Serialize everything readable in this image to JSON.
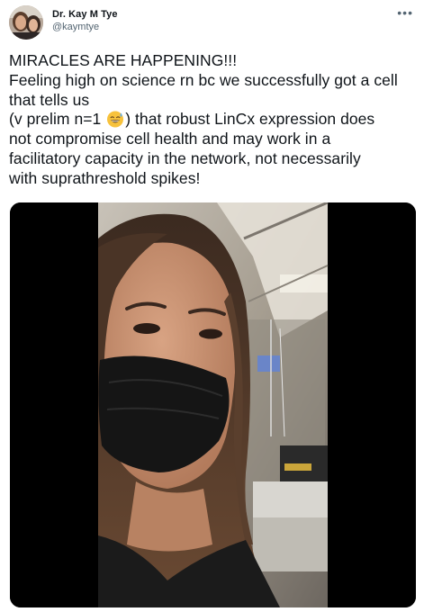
{
  "author": {
    "display_name": "Dr. Kay M Tye",
    "handle": "@kaymtye",
    "avatar_icon": "profile-photo"
  },
  "more_icon": "more-horizontal-icon",
  "tweet": {
    "line1": "MIRACLES ARE HAPPENING!!!",
    "line2": "Feeling high on science rn bc we successfully got a cell",
    "line3": "that tells us",
    "line4_before_emoji": "(v prelim n=1 ",
    "emoji": "grinning-sweat-emoji",
    "line4_after_emoji": ") that robust LinCx expression does",
    "line5": "not compromise cell health and may work in a",
    "line6": "facilitatory capacity in the network, not necessarily",
    "line7": "with suprathreshold spikes!"
  },
  "media": {
    "kind": "video-frame",
    "description_icon": "selfie-video-frame"
  },
  "colors": {
    "text": "#0f1419",
    "secondary": "#536471",
    "media_bg": "#000000"
  }
}
